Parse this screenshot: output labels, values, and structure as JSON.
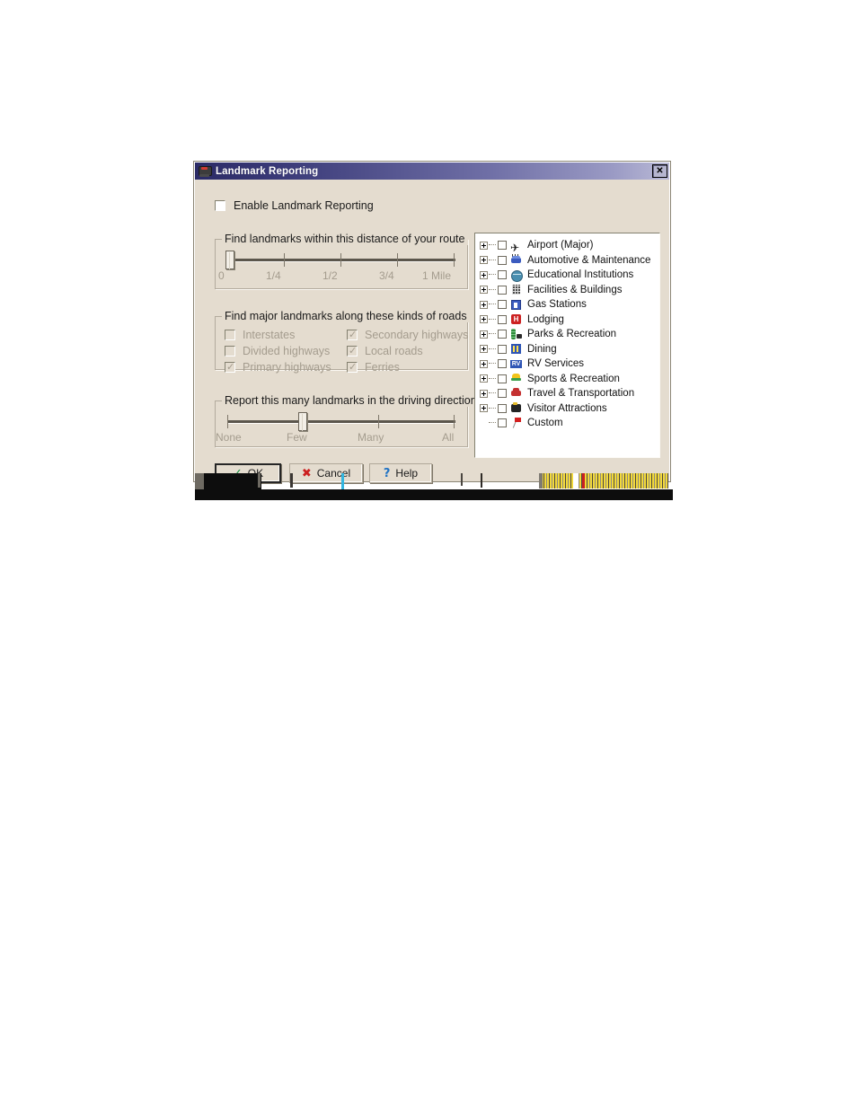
{
  "window": {
    "title": "Landmark Reporting",
    "icon": "map-monitor-icon",
    "close_label": "✕"
  },
  "enable": {
    "label": "Enable Landmark Reporting",
    "checked": false
  },
  "distance_group": {
    "legend": "Find landmarks within this distance of your route",
    "tick_labels": [
      "0",
      "1/4",
      "1/2",
      "3/4",
      "1 Mile"
    ],
    "value": "0",
    "enabled": false
  },
  "roads_group": {
    "legend": "Find major landmarks along these kinds of roads",
    "enabled": false,
    "column1": [
      {
        "label": "Interstates",
        "checked": false
      },
      {
        "label": "Divided highways",
        "checked": false
      },
      {
        "label": "Primary highways",
        "checked": true
      }
    ],
    "column2": [
      {
        "label": "Secondary highways",
        "checked": true
      },
      {
        "label": "Local roads",
        "checked": true
      },
      {
        "label": "Ferries",
        "checked": true
      }
    ]
  },
  "report_group": {
    "legend": "Report this many landmarks in the driving directions",
    "tick_labels": [
      "None",
      "Few",
      "Many",
      "All"
    ],
    "value": "Few",
    "enabled": false
  },
  "tree": {
    "items": [
      {
        "label": "Airport (Major)",
        "icon": "airplane-icon",
        "expandable": true,
        "checked": false
      },
      {
        "label": "Automotive & Maintenance",
        "icon": "car-icon",
        "expandable": true,
        "checked": false
      },
      {
        "label": "Educational Institutions",
        "icon": "globe-icon",
        "expandable": true,
        "checked": false
      },
      {
        "label": "Facilities & Buildings",
        "icon": "building-icon",
        "expandable": true,
        "checked": false
      },
      {
        "label": "Gas Stations",
        "icon": "gas-pump-icon",
        "expandable": true,
        "checked": false
      },
      {
        "label": "Lodging",
        "icon": "lodging-h-icon",
        "expandable": true,
        "checked": false
      },
      {
        "label": "Parks & Recreation",
        "icon": "park-tree-icon",
        "expandable": true,
        "checked": false
      },
      {
        "label": "Dining",
        "icon": "fork-knife-icon",
        "expandable": true,
        "checked": false
      },
      {
        "label": "RV Services",
        "icon": "rv-icon",
        "expandable": true,
        "checked": false
      },
      {
        "label": "Sports & Recreation",
        "icon": "sports-icon",
        "expandable": true,
        "checked": false
      },
      {
        "label": "Travel & Transportation",
        "icon": "travel-icon",
        "expandable": true,
        "checked": false
      },
      {
        "label": "Visitor Attractions",
        "icon": "camera-icon",
        "expandable": true,
        "checked": false
      },
      {
        "label": "Custom",
        "icon": "pushpin-icon",
        "expandable": false,
        "checked": false
      }
    ]
  },
  "buttons": {
    "ok": {
      "label": "OK",
      "glyph": "✓"
    },
    "cancel": {
      "label": "Cancel",
      "glyph": "✖"
    },
    "help": {
      "label": "Help",
      "glyph": "?"
    }
  },
  "colors": {
    "dialog_face": "#e4dccf",
    "titlebar_start": "#2b2b66",
    "titlebar_end": "#b9b9d6",
    "disabled_text": "#a49c8e",
    "ok_check": "#0f8a3c",
    "cancel_x": "#cc2020",
    "help_q": "#1f72c4"
  }
}
